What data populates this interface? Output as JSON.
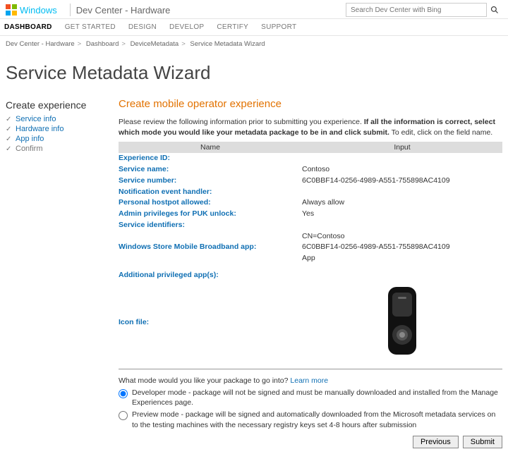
{
  "header": {
    "brand": "Windows",
    "site": "Dev Center - Hardware",
    "search_placeholder": "Search Dev Center with Bing"
  },
  "nav": {
    "items": [
      "DASHBOARD",
      "GET STARTED",
      "DESIGN",
      "DEVELOP",
      "CERTIFY",
      "SUPPORT"
    ],
    "active": 0
  },
  "crumbs": [
    "Dev Center - Hardware",
    "Dashboard",
    "DeviceMetadata",
    "Service Metadata Wizard"
  ],
  "page_title": "Service Metadata Wizard",
  "sidebar": {
    "heading": "Create experience",
    "steps": [
      {
        "label": "Service info",
        "done": true
      },
      {
        "label": "Hardware info",
        "done": true
      },
      {
        "label": "App info",
        "done": true
      },
      {
        "label": "Confirm",
        "done": false,
        "current": true
      }
    ]
  },
  "section_heading": "Create mobile operator experience",
  "instructions_plain": "Please review the following information prior to submitting you experience. ",
  "instructions_bold": "If all the information is correct, select which mode you would like your metadata package to be in and click submit.",
  "instructions_tail": " To edit, click on the field name.",
  "table": {
    "col1": "Name",
    "col2": "Input",
    "rows": [
      {
        "name": "Experience ID:",
        "value": ""
      },
      {
        "name": "Service name:",
        "value": "Contoso"
      },
      {
        "name": "Service number:",
        "value": "6C0BBF14-0256-4989-A551-755898AC4109"
      },
      {
        "name": "Notification event handler:",
        "value": ""
      },
      {
        "name": "Personal hostpot allowed:",
        "value": "Always allow"
      },
      {
        "name": "Admin privileges for PUK unlock:",
        "value": "Yes"
      },
      {
        "name": "Service identifiers:",
        "value": ""
      },
      {
        "name": "Windows Store Mobile Broadband app:",
        "value": "CN=Contoso\n6C0BBF14-0256-4989-A551-755898AC4109\nApp"
      },
      {
        "name": "Additional privileged app(s):",
        "value": ""
      },
      {
        "name": "Icon file:",
        "value": ""
      }
    ]
  },
  "mode": {
    "question": "What mode would you like your package to go into?",
    "learn": "Learn more",
    "dev": "Developer mode - package will not be signed and must be manually downloaded and installed from the Manage Experiences page.",
    "preview": "Preview mode - package will be signed and automatically downloaded from the Microsoft metadata services on to the testing machines with the necessary registry keys set 4-8 hours after submission"
  },
  "buttons": {
    "prev": "Previous",
    "submit": "Submit"
  }
}
